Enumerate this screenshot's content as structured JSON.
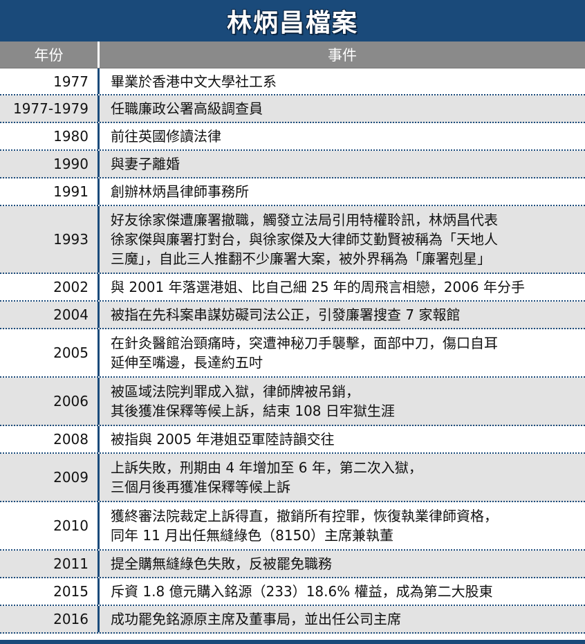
{
  "title": "林炳昌檔案",
  "headers": {
    "year": "年份",
    "event": "事件"
  },
  "rows": [
    {
      "year": "1977",
      "lines": [
        "畢業於香港中文大學社工系"
      ]
    },
    {
      "year": "1977-1979",
      "lines": [
        "任職廉政公署高級調查員"
      ]
    },
    {
      "year": "1980",
      "lines": [
        "前往英國修讀法律"
      ]
    },
    {
      "year": "1990",
      "lines": [
        "與妻子離婚"
      ]
    },
    {
      "year": "1991",
      "lines": [
        "創辦林炳昌律師事務所"
      ]
    },
    {
      "year": "1993",
      "lines": [
        "好友徐家傑遭廉署撤職，觸發立法局引用特權聆訊，林炳昌代表",
        "徐家傑與廉署打對台，與徐家傑及大律師艾勤賢被稱為「天地人",
        "三魔」，自此三人推翻不少廉署大案，被外界稱為「廉署剋星」"
      ]
    },
    {
      "year": "2002",
      "lines": [
        "與 2001 年落選港姐、比自己細 25 年的周飛言相戀，2006 年分手"
      ]
    },
    {
      "year": "2004",
      "lines": [
        "被指在先科案串謀妨礙司法公正，引發廉署搜查 7 家報館"
      ]
    },
    {
      "year": "2005",
      "lines": [
        "在針灸醫館治頸痛時，突遭神秘刀手襲擊，面部中刀，傷口自耳",
        "延伸至嘴邊，長達約五吋"
      ]
    },
    {
      "year": "2006",
      "lines": [
        "被區域法院判罪成入獄，律師牌被吊銷，",
        "其後獲准保釋等候上訴，結束 108 日牢獄生涯"
      ]
    },
    {
      "year": "2008",
      "lines": [
        "被指與 2005 年港姐亞軍陸詩韻交往"
      ]
    },
    {
      "year": "2009",
      "lines": [
        "上訴失敗，刑期由 4 年增加至 6 年，第二次入獄，",
        "三個月後再獲准保釋等候上訴"
      ]
    },
    {
      "year": "2010",
      "lines": [
        "獲終審法院裁定上訴得直，撤銷所有控罪，恢復執業律師資格，",
        "同年 11 月出任無縫綠色（8150）主席兼執董"
      ]
    },
    {
      "year": "2011",
      "lines": [
        "提全購無縫綠色失敗，反被罷免職務"
      ]
    },
    {
      "year": "2015",
      "lines": [
        "斥資 1.8 億元購入銘源（233）18.6% 權益，成為第二大股東"
      ]
    },
    {
      "year": "2016",
      "lines": [
        "成功罷免銘源原主席及董事局，並出任公司主席"
      ]
    }
  ],
  "colors": {
    "title_bg": "#1a4a7a",
    "header_bg": "#8a8a8a",
    "stripe": "#e3e3e3",
    "divider": "#1a4a7a"
  }
}
